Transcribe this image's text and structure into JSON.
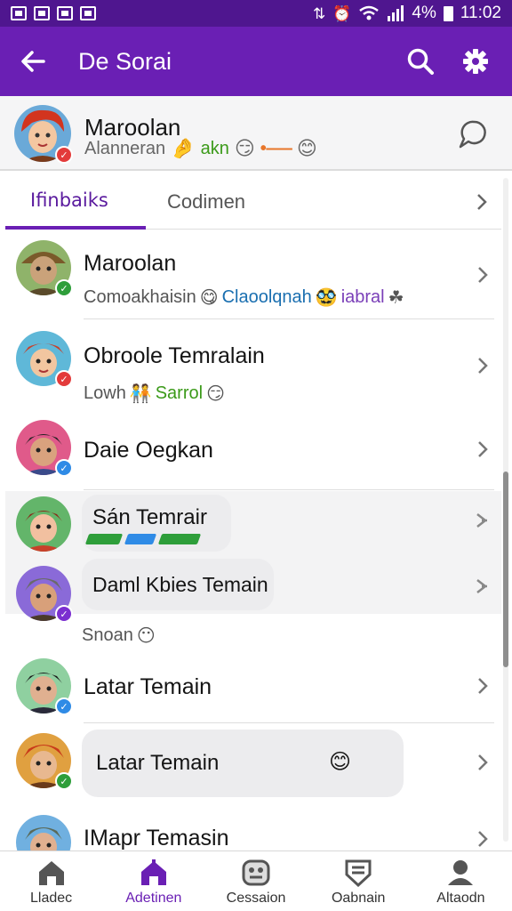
{
  "status_bar": {
    "battery": "4%",
    "time": "11:02"
  },
  "app_bar": {
    "title": "De Sorai"
  },
  "profile": {
    "name": "Maroolan",
    "status_text": "Alanneran",
    "status_accent": "akn"
  },
  "tabs": [
    {
      "label": "Ifinbaiks"
    },
    {
      "label": "Codimen"
    }
  ],
  "contacts": [
    {
      "name": "Maroolan",
      "sub": "Comoakhaisin",
      "sub_accent": "Claoolqnah",
      "sub_extra": "iabral"
    },
    {
      "name": "Obroole Temralain",
      "sub": "Lowh",
      "sub_accent": "Sarrol"
    },
    {
      "name": "Daie Oegkan"
    },
    {
      "name": "Sán Temrair"
    },
    {
      "name": "Daml Kbies Temain",
      "sub": "Snoan"
    },
    {
      "name": "Latar Temain"
    },
    {
      "name": "Latar Temain"
    },
    {
      "name": "IMapr Temasin"
    }
  ],
  "bottom_nav": [
    {
      "label": "Lladec"
    },
    {
      "label": "Adetinen"
    },
    {
      "label": "Cessaion"
    },
    {
      "label": "Oabnain"
    },
    {
      "label": "Altaodn"
    }
  ],
  "colors": {
    "status_bar": "#4f168f",
    "app_bar": "#6a1fb4",
    "accent": "#6a1fb4",
    "online_green": "#2e9e3a",
    "badge_red": "#e33b3b",
    "badge_blue": "#2f8be6",
    "badge_purple": "#7b2fd0"
  }
}
